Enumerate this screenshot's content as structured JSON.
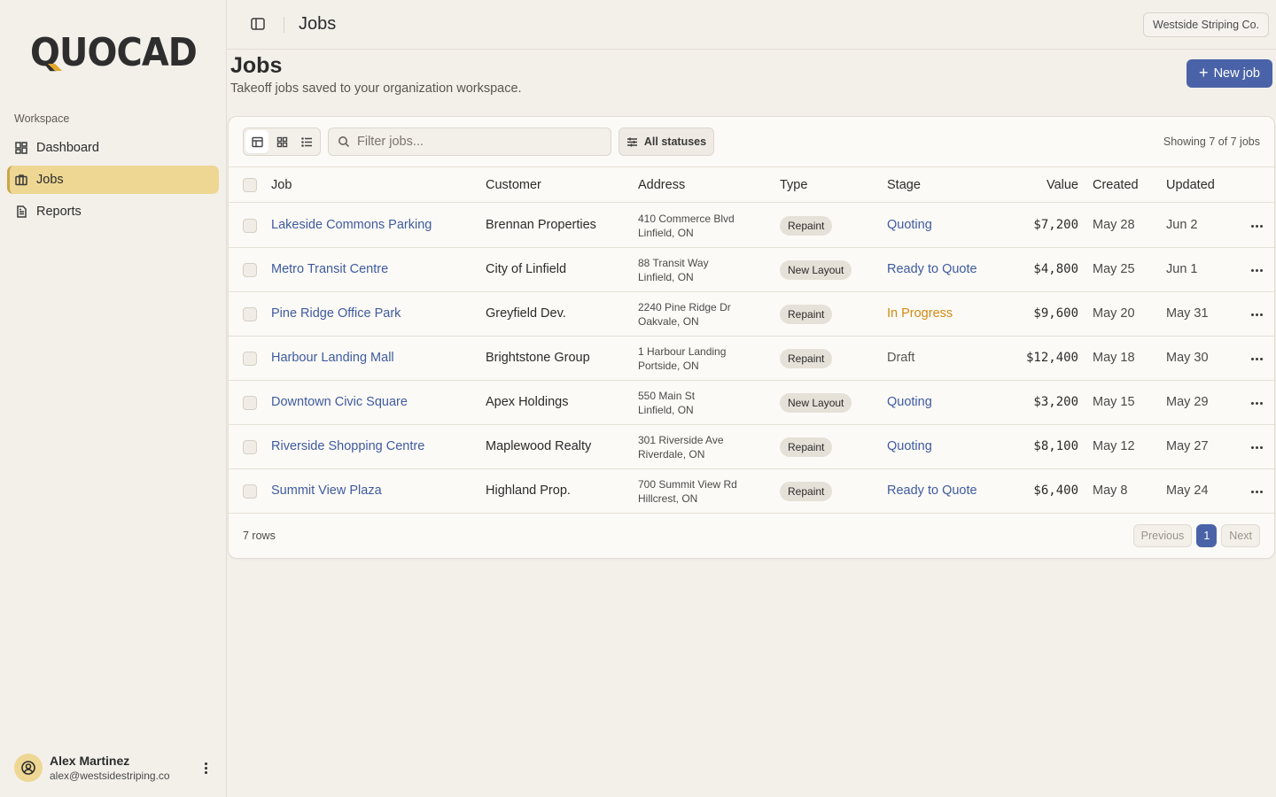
{
  "sidebar": {
    "logo_text": "QUOCAD",
    "section_label": "Workspace",
    "items": [
      {
        "label": "Dashboard",
        "icon": "dashboard-icon"
      },
      {
        "label": "Jobs",
        "icon": "briefcase-icon",
        "active": true
      },
      {
        "label": "Reports",
        "icon": "document-icon"
      }
    ],
    "user": {
      "name": "Alex Martinez",
      "email": "alex@westsidestriping.co"
    }
  },
  "topbar": {
    "title": "Jobs",
    "org": "Westside Striping Co."
  },
  "header": {
    "title": "Jobs",
    "subtitle": "Takeoff jobs saved to your organization workspace.",
    "new_button": "New job"
  },
  "toolbar": {
    "filter_placeholder": "Filter jobs...",
    "status_filter": "All statuses",
    "showing": "Showing 7 of 7 jobs"
  },
  "table": {
    "columns": [
      "Job",
      "Customer",
      "Address",
      "Type",
      "Stage",
      "Value",
      "Created",
      "Updated"
    ],
    "rows": [
      {
        "job": "Lakeside Commons Parking",
        "customer": "Brennan Properties",
        "addr1": "410 Commerce Blvd",
        "addr2": "Linfield, ON",
        "type": "Repaint",
        "stage": "Quoting",
        "value": "$7,200",
        "created": "May 28",
        "updated": "Jun 2"
      },
      {
        "job": "Metro Transit Centre",
        "customer": "City of Linfield",
        "addr1": "88 Transit Way",
        "addr2": "Linfield, ON",
        "type": "New Layout",
        "stage": "Ready to Quote",
        "value": "$4,800",
        "created": "May 25",
        "updated": "Jun 1"
      },
      {
        "job": "Pine Ridge Office Park",
        "customer": "Greyfield Dev.",
        "addr1": "2240 Pine Ridge Dr",
        "addr2": "Oakvale, ON",
        "type": "Repaint",
        "stage": "In Progress",
        "value": "$9,600",
        "created": "May 20",
        "updated": "May 31"
      },
      {
        "job": "Harbour Landing Mall",
        "customer": "Brightstone Group",
        "addr1": "1 Harbour Landing",
        "addr2": "Portside, ON",
        "type": "Repaint",
        "stage": "Draft",
        "value": "$12,400",
        "created": "May 18",
        "updated": "May 30"
      },
      {
        "job": "Downtown Civic Square",
        "customer": "Apex Holdings",
        "addr1": "550 Main St",
        "addr2": "Linfield, ON",
        "type": "New Layout",
        "stage": "Quoting",
        "value": "$3,200",
        "created": "May 15",
        "updated": "May 29"
      },
      {
        "job": "Riverside Shopping Centre",
        "customer": "Maplewood Realty",
        "addr1": "301 Riverside Ave",
        "addr2": "Riverdale, ON",
        "type": "Repaint",
        "stage": "Quoting",
        "value": "$8,100",
        "created": "May 12",
        "updated": "May 27"
      },
      {
        "job": "Summit View Plaza",
        "customer": "Highland Prop.",
        "addr1": "700 Summit View Rd",
        "addr2": "Hillcrest, ON",
        "type": "Repaint",
        "stage": "Ready to Quote",
        "value": "$6,400",
        "created": "May 8",
        "updated": "May 24"
      }
    ],
    "stage_colors": {
      "Quoting": "#3e5ba0",
      "Ready to Quote": "#3e5ba0",
      "In Progress": "#d08a12",
      "Draft": "#5a564f"
    }
  },
  "footer": {
    "rows_label": "7 rows",
    "previous": "Previous",
    "page": "1",
    "next": "Next"
  },
  "colors": {
    "accent": "#4a63a8",
    "active_nav": "#eed793"
  }
}
